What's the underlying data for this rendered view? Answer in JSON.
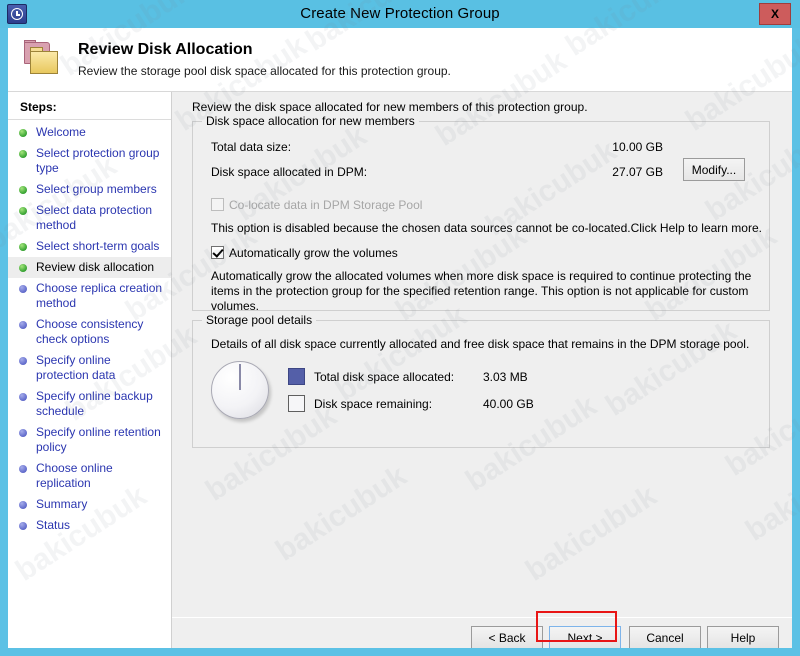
{
  "window": {
    "title": "Create New Protection Group",
    "app_icon": "clock-shield-icon",
    "close_label": "X",
    "accent_color": "#59c0e3"
  },
  "header": {
    "icon": "folders-icon",
    "title": "Review Disk Allocation",
    "subtitle": "Review the storage pool disk space allocated for this protection group."
  },
  "sidebar": {
    "heading": "Steps:",
    "items": [
      {
        "label": "Welcome",
        "state": "done"
      },
      {
        "label": "Select protection group type",
        "state": "done"
      },
      {
        "label": "Select group members",
        "state": "done"
      },
      {
        "label": "Select data protection method",
        "state": "done"
      },
      {
        "label": "Select short-term goals",
        "state": "done"
      },
      {
        "label": "Review disk allocation",
        "state": "current"
      },
      {
        "label": "Choose replica creation method",
        "state": "pending"
      },
      {
        "label": "Choose consistency check options",
        "state": "pending"
      },
      {
        "label": "Specify online protection data",
        "state": "pending"
      },
      {
        "label": "Specify online backup schedule",
        "state": "pending"
      },
      {
        "label": "Specify online retention policy",
        "state": "pending"
      },
      {
        "label": "Choose online replication",
        "state": "pending"
      },
      {
        "label": "Summary",
        "state": "pending"
      },
      {
        "label": "Status",
        "state": "pending"
      }
    ]
  },
  "main": {
    "intro": "Review the disk space allocated for new members of this protection group.",
    "allocation_group": {
      "title": "Disk space allocation for new members",
      "total_data_size_label": "Total data size:",
      "total_data_size_value": "10.00 GB",
      "dpm_allocated_label": "Disk space allocated in DPM:",
      "dpm_allocated_value": "27.07 GB",
      "modify_label": "Modify...",
      "colocate_label": "Co-locate data in DPM Storage Pool",
      "colocate_checked": false,
      "colocate_disabled": true,
      "colocate_help": "This option is disabled because the chosen data sources cannot be co-located.Click Help to learn more.",
      "autogrow_label": "Automatically grow the volumes",
      "autogrow_checked": true,
      "autogrow_desc": "Automatically grow the allocated volumes when more disk space is required to continue protecting the items in the protection group for the specified retention range. This option is not applicable for custom volumes."
    },
    "pool_group": {
      "title": "Storage pool details",
      "description": "Details of all disk space currently allocated and free disk space that remains in the DPM storage pool.",
      "legend": [
        {
          "label": "Total disk space allocated:",
          "value": "3.03 MB",
          "color": "#545fa8"
        },
        {
          "label": "Disk space remaining:",
          "value": "40.00 GB",
          "color": "#f6f6f8"
        }
      ]
    }
  },
  "footer": {
    "back_label": "< Back",
    "next_label": "Next >",
    "cancel_label": "Cancel",
    "help_label": "Help",
    "highlight_color": "#e81515"
  },
  "watermark": {
    "text": "bakicubuk"
  },
  "chart_data": {
    "type": "pie",
    "title": "Storage pool details",
    "categories": [
      "Total disk space allocated",
      "Disk space remaining"
    ],
    "values": [
      0.00303,
      40.0
    ],
    "unit": "GB",
    "display_values": [
      "3.03 MB",
      "40.00 GB"
    ],
    "colors": [
      "#545fa8",
      "#f6f6f8"
    ],
    "legend": "right"
  }
}
